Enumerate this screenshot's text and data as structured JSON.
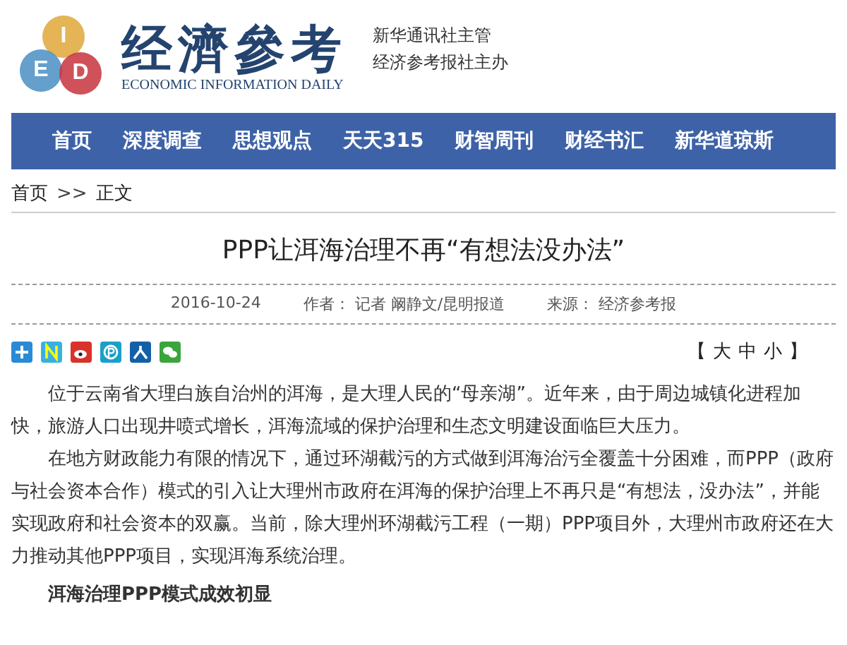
{
  "header": {
    "logo_letters": [
      "I",
      "E",
      "D"
    ],
    "brand": "经濟參考",
    "brand_en": "ECONOMIC INFORMATION DAILY",
    "taglines": [
      "新华通讯社主管",
      "经济参考报社主办"
    ]
  },
  "nav": {
    "items": [
      {
        "label": "首页",
        "selected": false
      },
      {
        "label": "深度调查",
        "selected": false
      },
      {
        "label": "思想观点",
        "selected": false
      },
      {
        "label": "天天315",
        "selected": false
      },
      {
        "label": "财智周刊",
        "selected": false
      },
      {
        "label": "财经书汇",
        "selected": false
      },
      {
        "label": "新华道琼斯",
        "selected": false
      }
    ]
  },
  "breadcrumb": {
    "items": [
      "首页",
      "正文"
    ],
    "separator": ">>"
  },
  "article": {
    "title": "PPP让洱海治理不再“有想法没办法”",
    "date": "2016-10-24",
    "author_label": "作者：",
    "author": "记者 阚静文/昆明报道",
    "source_label": "来源：",
    "source": "经济参考报",
    "font_size": {
      "open": "【",
      "options": [
        "大",
        "中",
        "小"
      ],
      "close": "】"
    },
    "blocks": [
      {
        "kind": "paragraph",
        "text": "位于云南省大理白族自治州的洱海，是大理人民的“母亲湖”。近年来，由于周边城镇化进程加快，旅游人口出现井喷式增长，洱海流域的保护治理和生态文明建设面临巨大压力。"
      },
      {
        "kind": "paragraph",
        "text": "在地方财政能力有限的情况下，通过环湖截污的方式做到洱海治污全覆盖十分困难，而PPP（政府与社会资本合作）模式的引入让大理州市政府在洱海的保护治理上不再只是“有想法，没办法”，并能实现政府和社会资本的双赢。当前，除大理州环湖截污工程（一期）PPP项目外，大理州市政府还在大力推动其他PPP项目，实现洱海系统治理。"
      },
      {
        "kind": "subheading",
        "text": "洱海治理PPP模式成效初显"
      }
    ]
  }
}
